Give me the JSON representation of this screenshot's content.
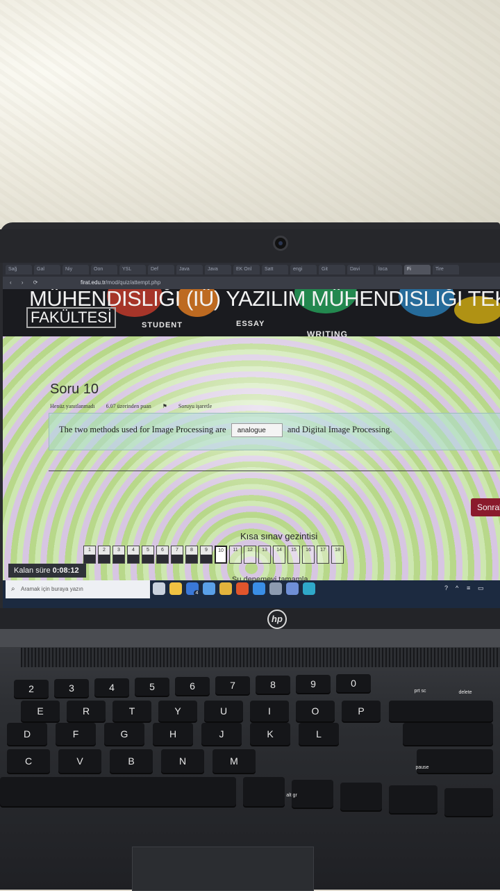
{
  "browser": {
    "tabs": [
      "Sağ",
      "Gal",
      "Niy",
      "Oon",
      "YSL",
      "Def",
      "Java",
      "Java",
      "EK Onl",
      "Satt",
      "engi",
      "Git",
      "Davi",
      "loca",
      "Fi",
      "Tire"
    ],
    "active_tab_index": 14,
    "url_domain": "firat.edu.tr",
    "url_path": "/mod/quiz/attempt.php"
  },
  "banner": {
    "title": "MÜHENDİSLİĞİ (İÜ) YAZILIM MÜHENDİSLİĞİ TEKNOLO",
    "subtitle": "FAKÜLTESİ",
    "student": "STUDENT",
    "essay": "ESSAY",
    "writing": "WRITING"
  },
  "question": {
    "title": "Soru 10",
    "status": "Henüz yanıtlanmadı",
    "points": "6.07 üzerinden puan",
    "flag_label": "Soruyu işaretle",
    "text_before": "The two methods used for Image Processing are",
    "answer_value": "analogue",
    "text_after": "and Digital Image Processing."
  },
  "next_button": "Sonraki",
  "quiz_nav": {
    "title": "Kısa sınav gezintisi",
    "current": 10,
    "items": [
      {
        "label": "1",
        "state": "answered"
      },
      {
        "label": "2",
        "state": "answered"
      },
      {
        "label": "3",
        "state": "answered"
      },
      {
        "label": "4",
        "state": "answered"
      },
      {
        "label": "5",
        "state": "answered"
      },
      {
        "label": "6",
        "state": "answered"
      },
      {
        "label": "7",
        "state": "answered"
      },
      {
        "label": "8",
        "state": "answered"
      },
      {
        "label": "9",
        "state": "answered"
      },
      {
        "label": "10",
        "state": "current"
      },
      {
        "label": "11",
        "state": "empty"
      },
      {
        "label": "12",
        "state": "empty"
      },
      {
        "label": "13",
        "state": "empty"
      },
      {
        "label": "14",
        "state": "empty"
      },
      {
        "label": "15",
        "state": "empty"
      },
      {
        "label": "16",
        "state": "empty"
      },
      {
        "label": "17",
        "state": "empty"
      },
      {
        "label": "18",
        "state": "empty"
      }
    ],
    "finish_label": "Şu denemeyi tamamla..."
  },
  "timer": {
    "label": "Kalan süre",
    "value": "0:08:12"
  },
  "taskbar": {
    "search_placeholder": "Aramak için buraya yazın",
    "mail_badge": "4",
    "apps": [
      {
        "name": "task-view-icon",
        "color": "#c9d1dd"
      },
      {
        "name": "file-explorer-icon",
        "color": "#f0c242"
      },
      {
        "name": "mail-icon",
        "color": "#3a78d8"
      },
      {
        "name": "app-icon",
        "color": "#5aa0e8"
      },
      {
        "name": "chrome-icon",
        "color": "#e3b33c"
      },
      {
        "name": "opera-icon",
        "color": "#e0552c"
      },
      {
        "name": "vscode-icon",
        "color": "#3a8ee6"
      },
      {
        "name": "app2-icon",
        "color": "#8d9bb0"
      },
      {
        "name": "app3-icon",
        "color": "#6f8fd6"
      },
      {
        "name": "edge-icon",
        "color": "#2fa8c9"
      }
    ]
  },
  "laptop": {
    "brand": "hp"
  },
  "keyboard": {
    "row1": [
      "2",
      "3",
      "4",
      "5",
      "6",
      "7",
      "8",
      "9",
      "0"
    ],
    "row2": [
      "E",
      "R",
      "T",
      "Y",
      "U",
      "I",
      "O",
      "P"
    ],
    "row3": [
      "D",
      "F",
      "G",
      "H",
      "J",
      "K",
      "L"
    ],
    "row4": [
      "C",
      "V",
      "B",
      "N",
      "M"
    ],
    "fn_labels": [
      "prt sc",
      "delete",
      "pause",
      "alt gr"
    ]
  }
}
